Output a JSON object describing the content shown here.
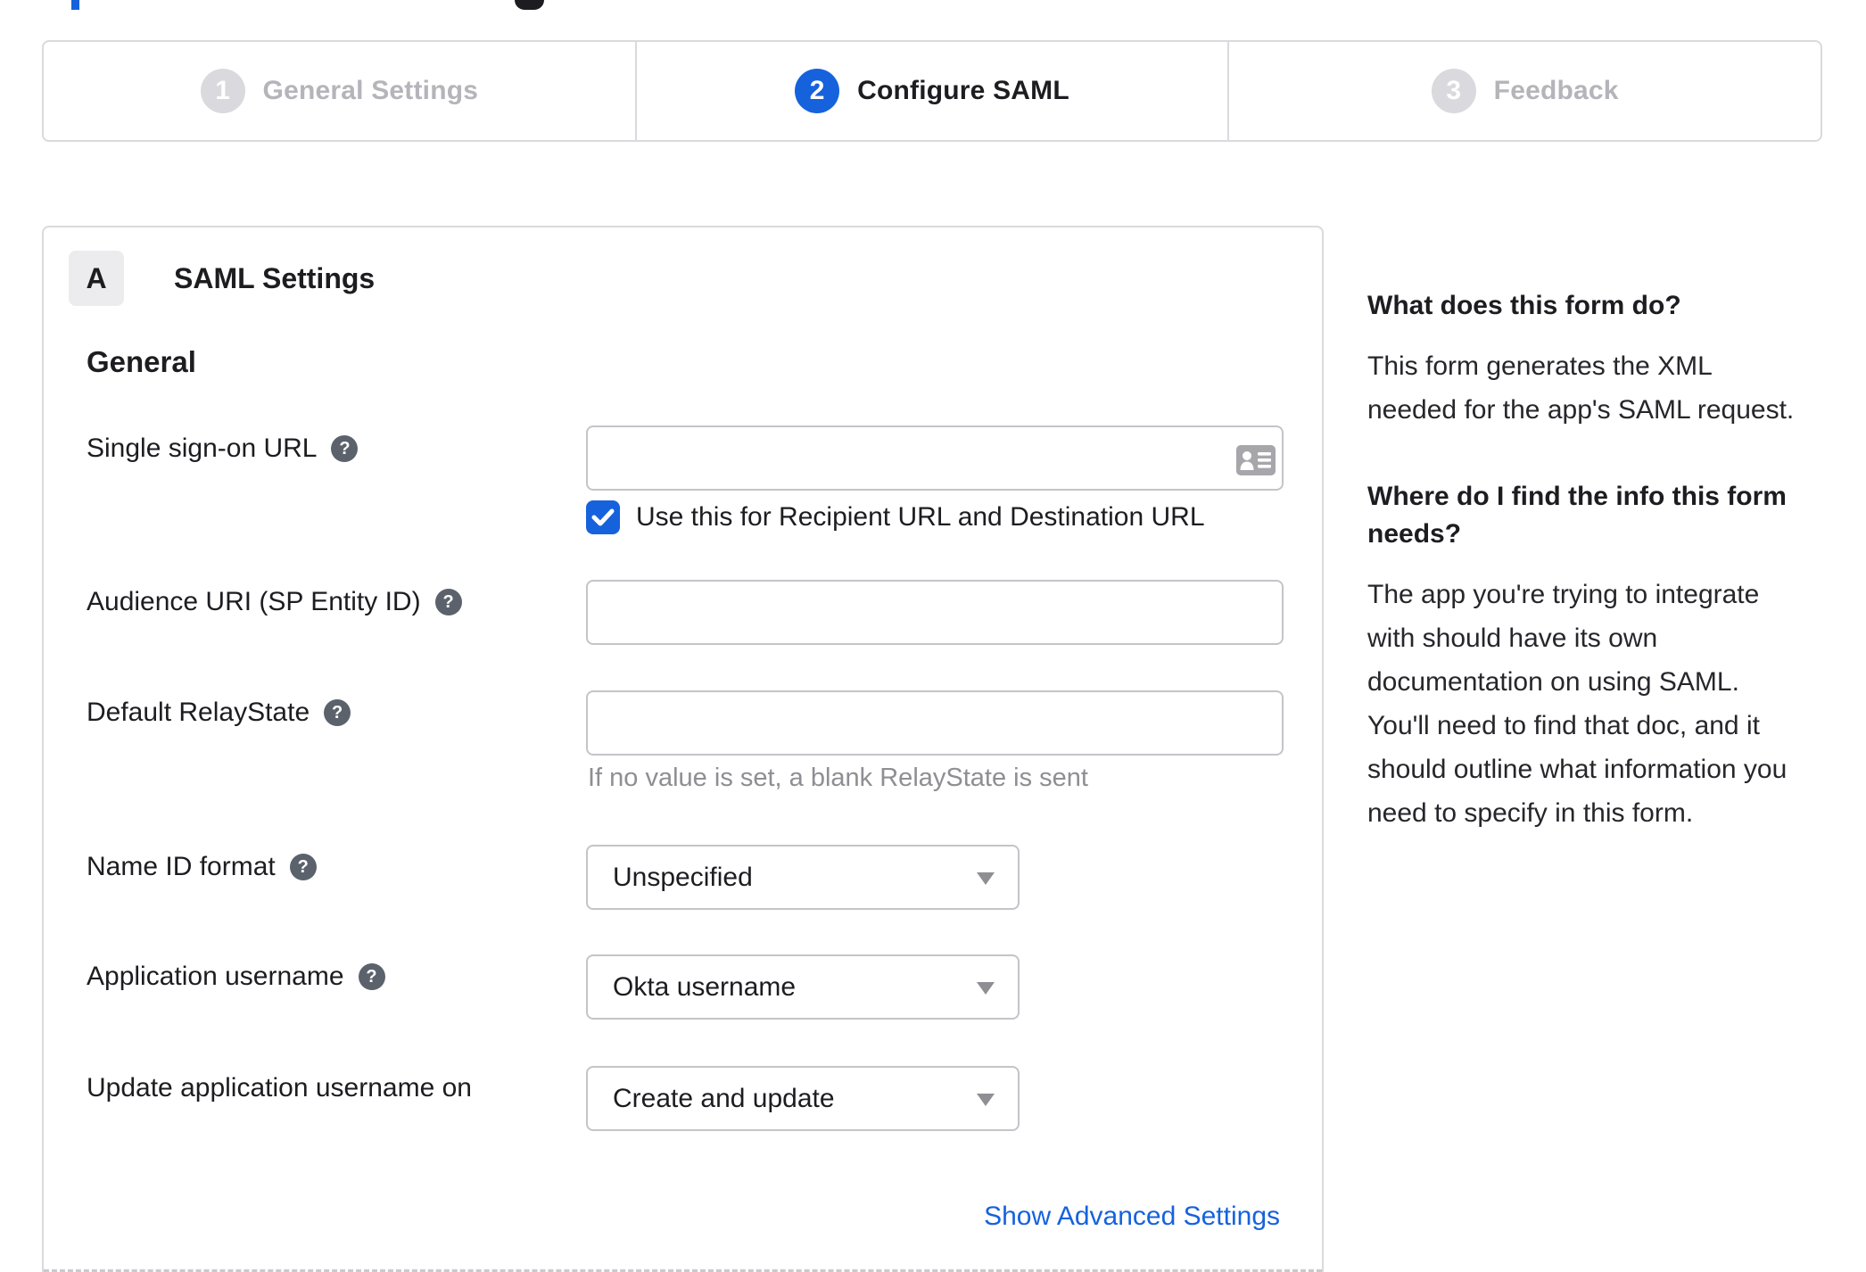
{
  "colors": {
    "accent": "#1662dd",
    "text_dark": "#1d1d21",
    "text_muted": "#8e8e93",
    "step_inactive_text": "#b4b4ba",
    "step_inactive_circle": "#d9d9de",
    "border": "#dadade"
  },
  "stepper": {
    "steps": [
      {
        "number": "1",
        "label": "General Settings",
        "state": "inactive"
      },
      {
        "number": "2",
        "label": "Configure SAML",
        "state": "active"
      },
      {
        "number": "3",
        "label": "Feedback",
        "state": "inactive"
      }
    ]
  },
  "panel": {
    "badge": "A",
    "title": "SAML Settings",
    "group": "General",
    "help_glyph": "?",
    "sso": {
      "label": "Single sign-on URL",
      "value": ""
    },
    "sso_check": {
      "label": "Use this for Recipient URL and Destination URL",
      "checked": true
    },
    "audience": {
      "label": "Audience URI (SP Entity ID)",
      "value": ""
    },
    "relay": {
      "label": "Default RelayState",
      "value": "",
      "hint": "If no value is set, a blank RelayState is sent"
    },
    "name_id": {
      "label": "Name ID format",
      "value": "Unspecified"
    },
    "app_user": {
      "label": "Application username",
      "value": "Okta username"
    },
    "update_user": {
      "label": "Update application username on",
      "value": "Create and update"
    },
    "advanced_link": "Show Advanced Settings"
  },
  "sidebar": {
    "q1": "What does this form do?",
    "a1": "This form generates the XML needed for the app's SAML request.",
    "q2": "Where do I find the info this form needs?",
    "a2": "The app you're trying to integrate with should have its own documentation on using SAML. You'll need to find that doc, and it should outline what information you need to specify in this form."
  }
}
